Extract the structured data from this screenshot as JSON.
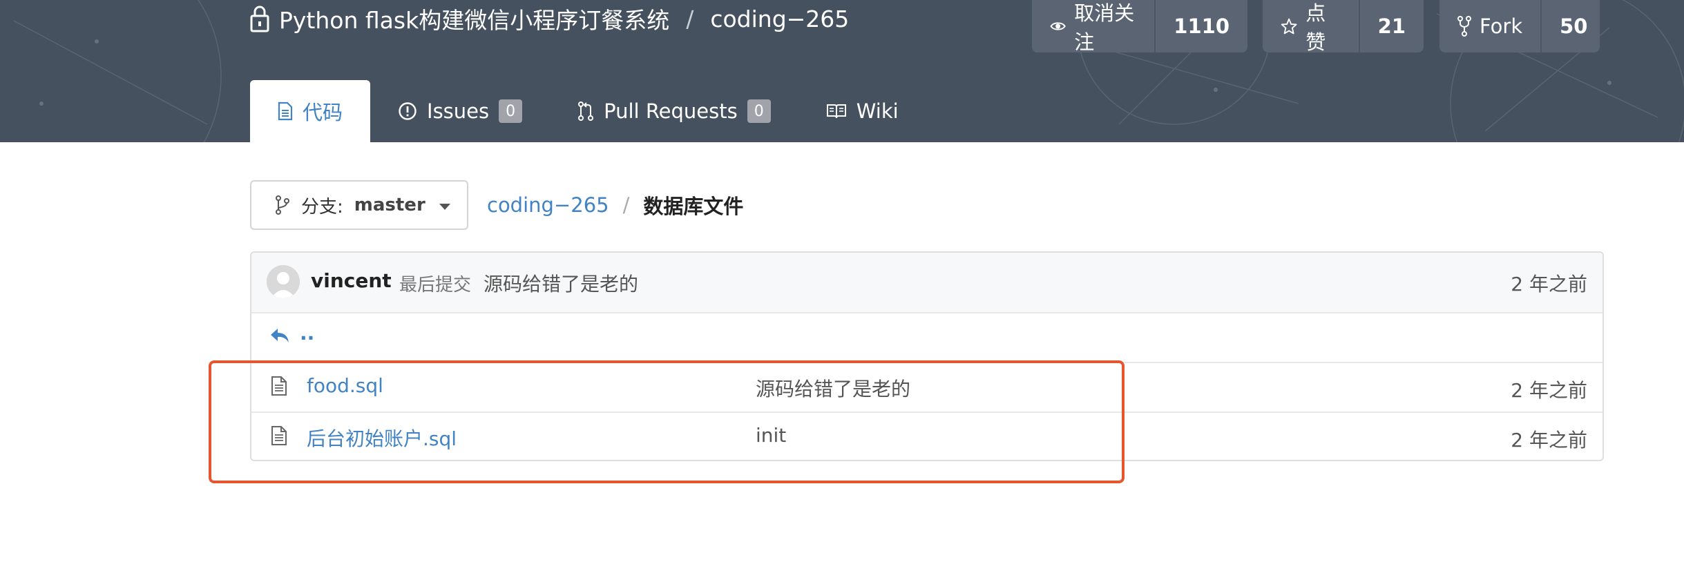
{
  "header": {
    "repo_owner_title": "Python flask构建微信小程序订餐系统",
    "separator": "/",
    "repo_name": "coding−265",
    "watch": {
      "label": "取消关注",
      "count": "1110"
    },
    "star": {
      "label": "点赞",
      "count": "21"
    },
    "fork": {
      "label": "Fork",
      "count": "50"
    },
    "tabs": [
      {
        "label": "代码",
        "active": true,
        "icon": "code-file-icon"
      },
      {
        "label": "Issues",
        "badge": "0",
        "icon": "issue-icon"
      },
      {
        "label": "Pull Requests",
        "badge": "0",
        "icon": "pull-request-icon"
      },
      {
        "label": "Wiki",
        "icon": "book-icon"
      }
    ]
  },
  "path_bar": {
    "branch_label": "分支:",
    "branch_value": "master",
    "repo_link": "coding−265",
    "separator": "/",
    "current_dir": "数据库文件"
  },
  "commit": {
    "author": "vincent",
    "label": "最后提交",
    "message": "源码给错了是老的",
    "time": "2 年之前"
  },
  "parent": {
    "label": ".."
  },
  "files": [
    {
      "name": "food.sql",
      "message": "源码给错了是老的",
      "time": "2 年之前"
    },
    {
      "name": "后台初始账户.sql",
      "message": "init",
      "time": "2 年之前"
    }
  ],
  "colors": {
    "header_bg": "#46515f",
    "link": "#4183c4",
    "highlight": "#e5562e"
  }
}
